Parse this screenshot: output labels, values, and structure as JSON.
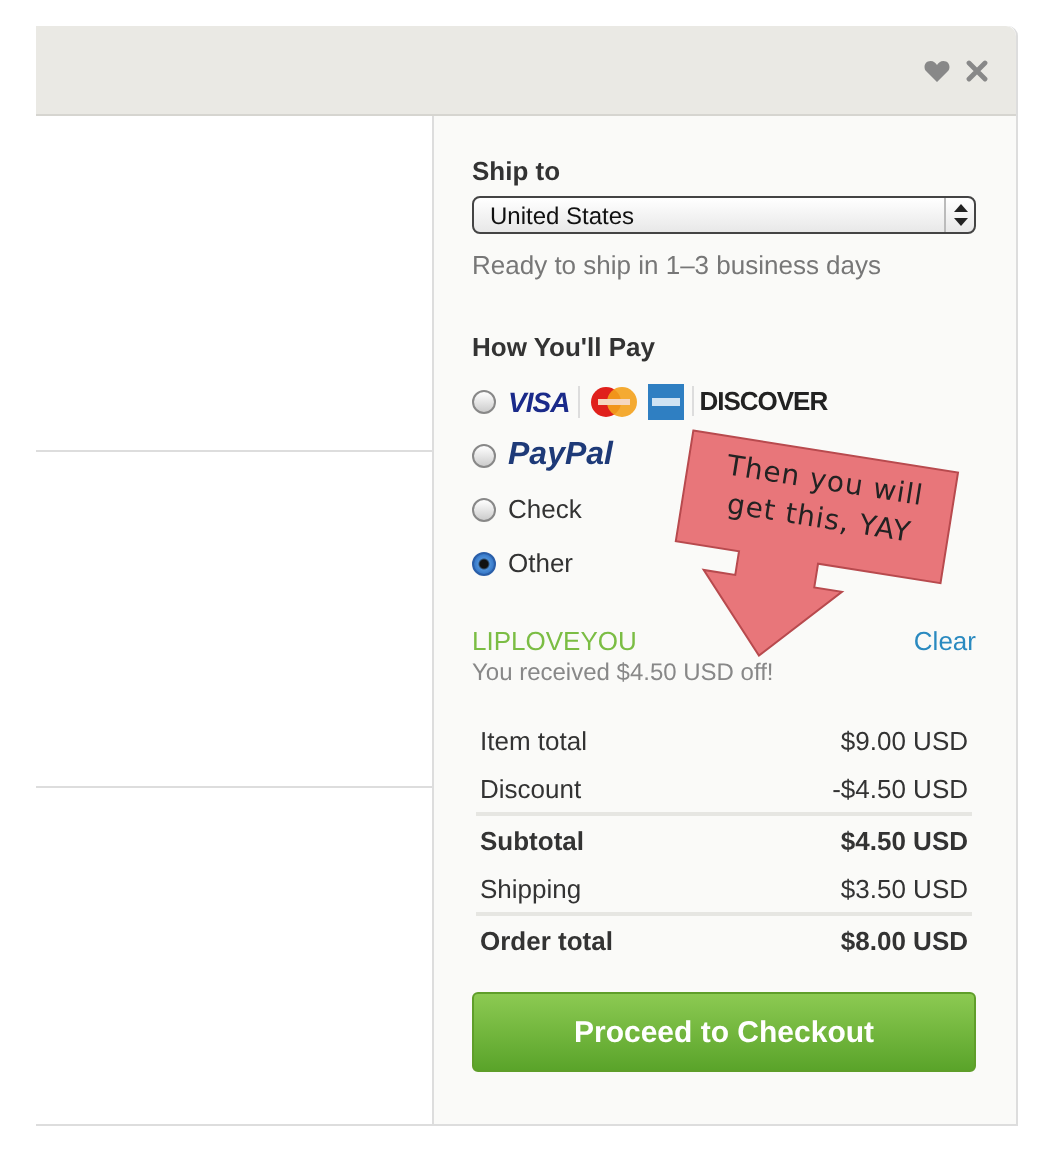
{
  "header": {
    "favorite": false
  },
  "ship_to": {
    "label": "Ship to",
    "country": "United States",
    "note": "Ready to ship in 1–3 business days"
  },
  "payment": {
    "label": "How You'll Pay",
    "options": [
      {
        "kind": "cards",
        "selected": false,
        "logos": [
          {
            "kind": "wordmark",
            "text": "VISA"
          },
          {
            "kind": "mastercard"
          },
          {
            "kind": "amex"
          },
          {
            "kind": "wordmark",
            "text": "DISCOVER"
          }
        ]
      },
      {
        "kind": "paypal",
        "selected": false,
        "label": "PayPal"
      },
      {
        "kind": "text",
        "selected": false,
        "label": "Check"
      },
      {
        "kind": "text",
        "selected": true,
        "label": "Other"
      }
    ]
  },
  "coupon": {
    "code": "LIPLOVEYOU",
    "action": "Clear",
    "message": "You received $4.50 USD off!"
  },
  "totals": [
    {
      "label": "Item total",
      "amount": "$9.00 USD",
      "bold": false,
      "rule_above": false
    },
    {
      "label": "Discount",
      "amount": "-$4.50 USD",
      "bold": false,
      "rule_above": false
    },
    {
      "label": "Subtotal",
      "amount": "$4.50 USD",
      "bold": true,
      "rule_above": true
    },
    {
      "label": "Shipping",
      "amount": "$3.50 USD",
      "bold": false,
      "rule_above": false
    },
    {
      "label": "Order total",
      "amount": "$8.00 USD",
      "bold": true,
      "rule_above": true
    }
  ],
  "checkout_button": "Proceed to Checkout",
  "callout": {
    "text": "Then you will get this, YAY"
  }
}
